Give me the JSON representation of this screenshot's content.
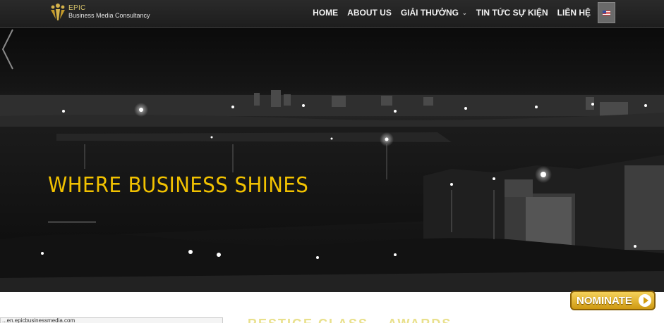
{
  "header": {
    "logo_line1": "EPIC",
    "logo_line2": "Business Media Consultancy",
    "nav": [
      {
        "label": "HOME",
        "has_dropdown": false
      },
      {
        "label": "ABOUT US",
        "has_dropdown": false
      },
      {
        "label": "GIẢI THƯỞNG",
        "has_dropdown": true
      },
      {
        "label": "TIN TỨC SỰ KIỆN",
        "has_dropdown": false
      },
      {
        "label": "LIÊN HỆ",
        "has_dropdown": false
      }
    ],
    "language_icon": "us-flag-icon"
  },
  "hero": {
    "title": "WHERE BUSINESS SHINES",
    "prev_icon": "chevron-left-icon"
  },
  "nominate_label": "NOMINATE",
  "status_url": "...en.epicbusinessmedia.com",
  "below_heading": "...RESTIGE CLASS... AWARDS..."
}
